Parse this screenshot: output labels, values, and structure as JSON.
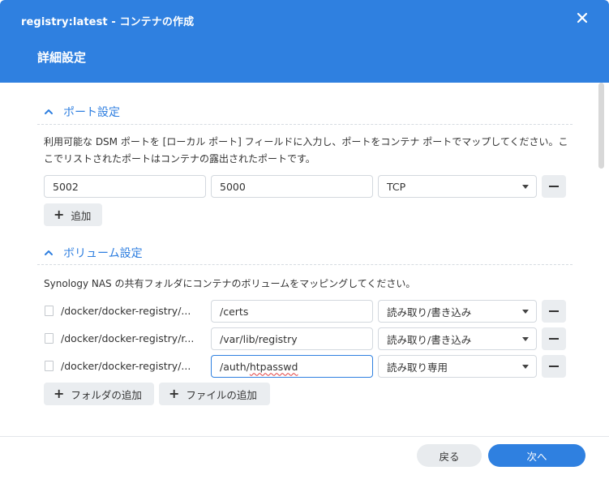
{
  "window": {
    "title": "registry:latest - コンテナの作成",
    "subtitle": "詳細設定",
    "close_icon": "close-icon"
  },
  "port_section": {
    "title": "ポート設定",
    "description": "利用可能な DSM ポートを [ローカル ポート] フィールドに入力し、ポートをコンテナ ポートでマップしてください。ここでリストされたポートはコンテナの露出されたポートです。",
    "rows": [
      {
        "local_port": "5002",
        "container_port": "5000",
        "protocol": "TCP"
      }
    ],
    "add_label": "追加"
  },
  "volume_section": {
    "title": "ボリューム設定",
    "description": "Synology NAS の共有フォルダにコンテナのボリュームをマッピングしてください。",
    "rows": [
      {
        "path": "/docker/docker-registry/...",
        "mount": "/certs",
        "mode": "読み取り/書き込み"
      },
      {
        "path": "/docker/docker-registry/r...",
        "mount": "/var/lib/registry",
        "mode": "読み取り/書き込み"
      },
      {
        "path": "/docker/docker-registry/...",
        "mount_prefix": "/auth/",
        "mount_misspelled": "htpasswd",
        "mode": "読み取り専用"
      }
    ],
    "add_folder_label": "フォルダの追加",
    "add_file_label": "ファイルの追加"
  },
  "footer": {
    "back_label": "戻る",
    "next_label": "次へ"
  },
  "colors": {
    "accent": "#2f80e0",
    "section_title": "#2f7fe0",
    "focus_border": "#2f80e0",
    "spellcheck": "#e04040"
  }
}
